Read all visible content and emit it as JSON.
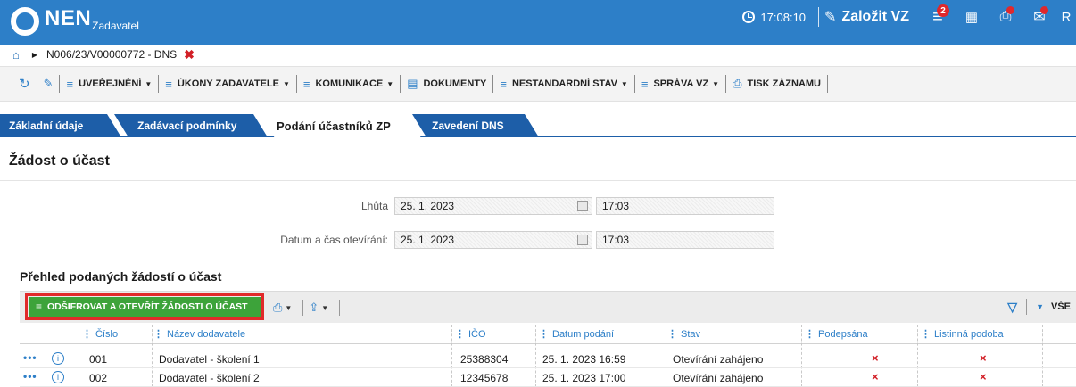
{
  "header": {
    "logo_text": "NEN",
    "logo_sub": "Zadavatel",
    "time": "17:08:10",
    "create_label": "Založit VZ",
    "notif_count": "2",
    "user_initial": "R"
  },
  "breadcrumb": {
    "record": "N006/23/V00000772 - DNS"
  },
  "toolbar": {
    "items": [
      "UVEŘEJNĚNÍ",
      "ÚKONY ZADAVATELE",
      "KOMUNIKACE",
      "DOKUMENTY",
      "NESTANDARDNÍ STAV",
      "SPRÁVA VZ",
      "TISK ZÁZNAMU"
    ]
  },
  "tabs": [
    "Základní údaje",
    "Zadávací podmínky",
    "Podání účastníků ZP",
    "Zavedení DNS"
  ],
  "section_title": "Žádost o účast",
  "form": {
    "deadline_label": "Lhůta",
    "deadline_date": "25. 1. 2023",
    "deadline_time": "17:03",
    "open_label": "Datum a čas otevírání:",
    "open_date": "25. 1. 2023",
    "open_time": "17:03"
  },
  "overview_title": "Přehled podaných žádostí o účast",
  "grid": {
    "action_button": "ODŠIFROVAT A OTEVŘÍT ŽÁDOSTI O ÚČAST",
    "filter_scope": "VŠE",
    "columns": [
      "Číslo",
      "Název dodavatele",
      "IČO",
      "Datum podání",
      "Stav",
      "Podepsána",
      "Listinná podoba"
    ],
    "rows": [
      {
        "cislo": "001",
        "nazev": "Dodavatel - školení 1",
        "ico": "25388304",
        "datum": "25. 1. 2023 16:59",
        "stav": "Otevírání zahájeno",
        "podepsana": "×",
        "listinna": "×"
      },
      {
        "cislo": "002",
        "nazev": "Dodavatel - školení 2",
        "ico": "12345678",
        "datum": "25. 1. 2023 17:00",
        "stav": "Otevírání zahájeno",
        "podepsana": "×",
        "listinna": "×"
      }
    ]
  },
  "colors": {
    "brand_blue": "#2d7fc8",
    "tab_blue": "#1d5ea8",
    "action_green": "#3da33a",
    "alert_red": "#e0282c"
  }
}
